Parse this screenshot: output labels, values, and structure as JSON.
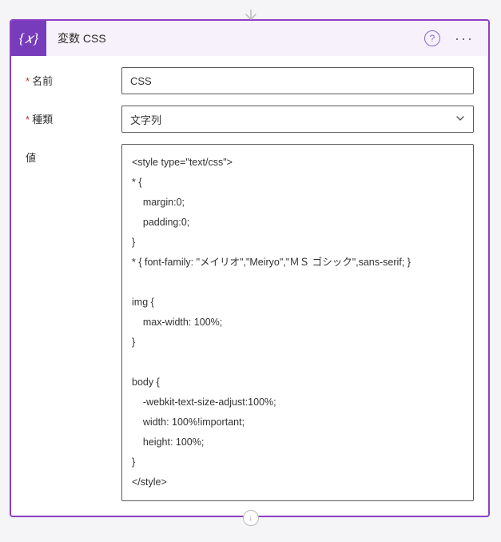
{
  "header": {
    "title": "変数 CSS",
    "help_glyph": "?",
    "more_glyph": "···"
  },
  "fields": {
    "name_label": "名前",
    "name_value": "CSS",
    "type_label": "種類",
    "type_value": "文字列",
    "value_label": "値",
    "value_content": "<style type=\"text/css\">\n* {\n    margin:0;\n    padding:0;\n}\n* { font-family: \"メイリオ\",\"Meiryo\",\"ＭＳ ゴシック\",sans-serif; }\n\nimg {\n    max-width: 100%;\n}\n\nbody {\n    -webkit-text-size-adjust:100%;\n    width: 100%!important;\n    height: 100%;\n}\n</style>"
  },
  "icon": {
    "variable_glyph": "{𝑥}"
  }
}
